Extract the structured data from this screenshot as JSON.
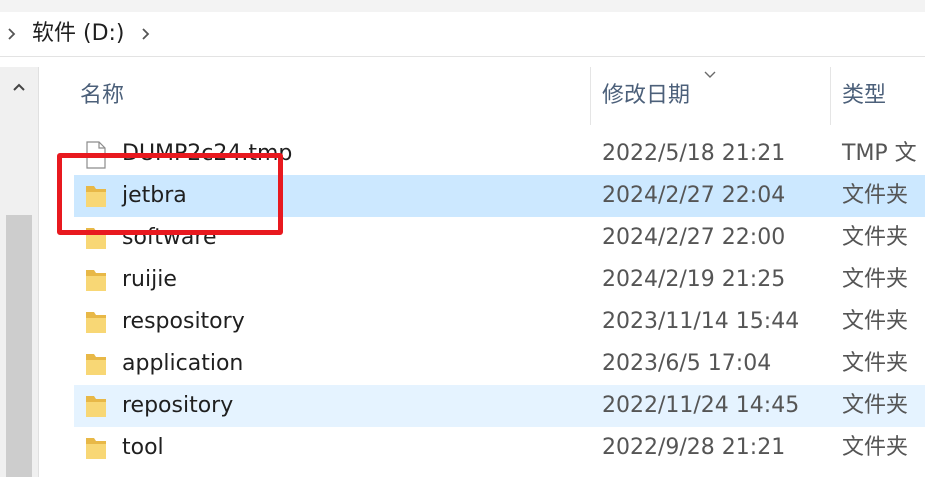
{
  "breadcrumb": {
    "location_label": "软件 (D:)"
  },
  "columns": {
    "name": "名称",
    "date_modified": "修改日期",
    "type": "类型"
  },
  "files": [
    {
      "name": "DUMP2c24.tmp",
      "date": "2022/5/18 21:21",
      "type": "TMP 文",
      "icon": "file-icon",
      "state": "normal"
    },
    {
      "name": "jetbra",
      "date": "2024/2/27 22:04",
      "type": "文件夹",
      "icon": "folder-icon",
      "state": "selected"
    },
    {
      "name": "software",
      "date": "2024/2/27 22:00",
      "type": "文件夹",
      "icon": "folder-icon",
      "state": "normal"
    },
    {
      "name": "ruijie",
      "date": "2024/2/19 21:25",
      "type": "文件夹",
      "icon": "folder-icon",
      "state": "normal"
    },
    {
      "name": "respository",
      "date": "2023/11/14 15:44",
      "type": "文件夹",
      "icon": "folder-icon",
      "state": "normal"
    },
    {
      "name": "application",
      "date": "2023/6/5 17:04",
      "type": "文件夹",
      "icon": "folder-icon",
      "state": "normal"
    },
    {
      "name": "repository",
      "date": "2022/11/24 14:45",
      "type": "文件夹",
      "icon": "folder-icon",
      "state": "hover"
    },
    {
      "name": "tool",
      "date": "2022/9/28 21:21",
      "type": "文件夹",
      "icon": "folder-icon",
      "state": "normal"
    }
  ],
  "colors": {
    "selected_row": "#cce8ff",
    "hover_row": "#e5f3ff",
    "annotation": "#e8191f",
    "folder_yellow": "#f8d775"
  }
}
